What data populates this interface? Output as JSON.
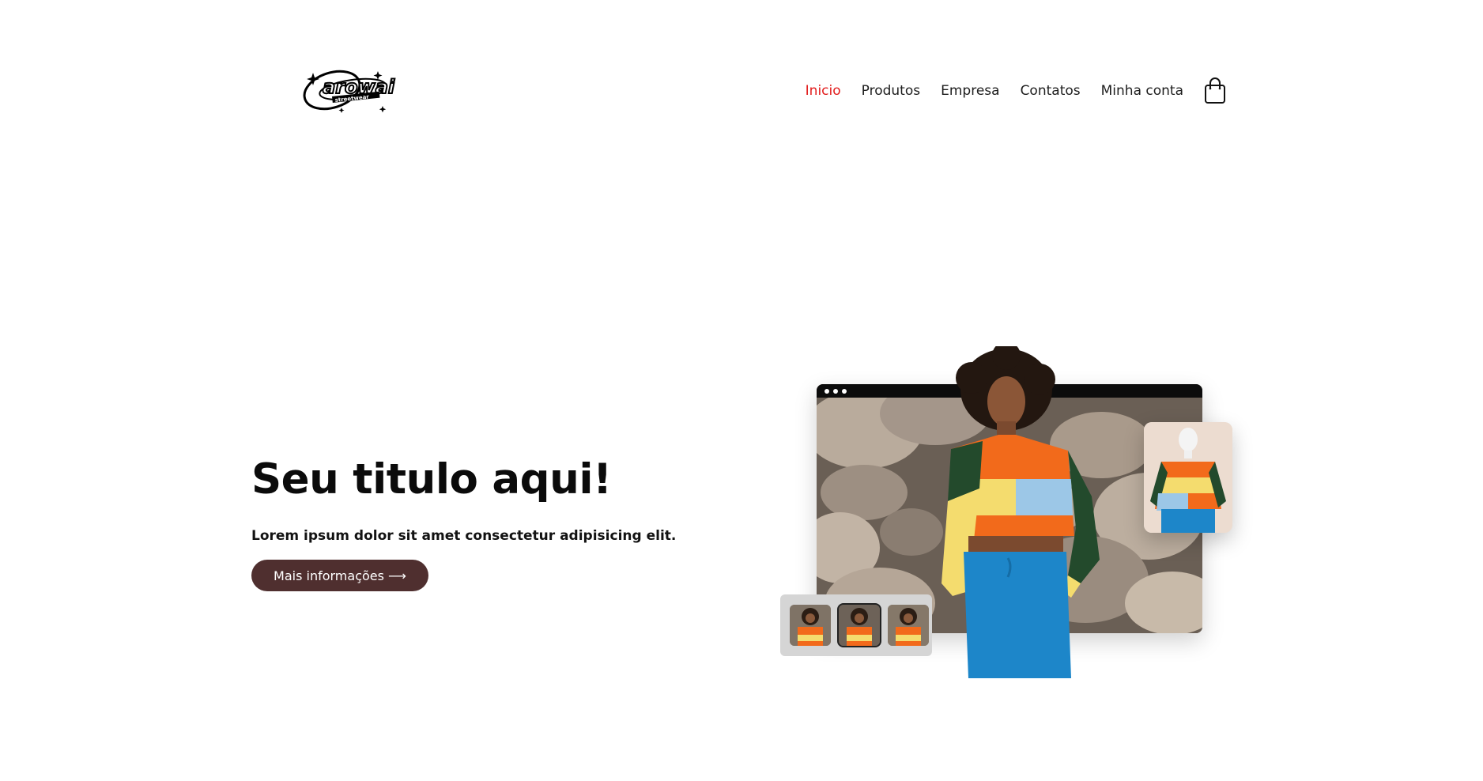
{
  "brand": {
    "logo_alt": "arowai streetwear logo"
  },
  "nav": {
    "items": [
      {
        "label": "Inicio",
        "active": true
      },
      {
        "label": "Produtos",
        "active": false
      },
      {
        "label": "Empresa",
        "active": false
      },
      {
        "label": "Contatos",
        "active": false
      },
      {
        "label": "Minha conta",
        "active": false
      }
    ],
    "cart_icon": "shopping-bag-icon",
    "active_color": "#e21b1b"
  },
  "hero": {
    "title": "Seu titulo aqui!",
    "subtitle": "Lorem ipsum dolor sit amet consectetur adipisicing elit.",
    "button_label": "Mais informações ⟶",
    "button_color": "#4f2f2f"
  },
  "illustration": {
    "thumbnails": [
      {
        "selected": false
      },
      {
        "selected": true
      },
      {
        "selected": false
      }
    ],
    "colors": {
      "orange": "#f26a1b",
      "yellow": "#f4dc6e",
      "green": "#234a2c",
      "blue": "#1d86c9",
      "light_blue": "#9cc7e7"
    }
  }
}
